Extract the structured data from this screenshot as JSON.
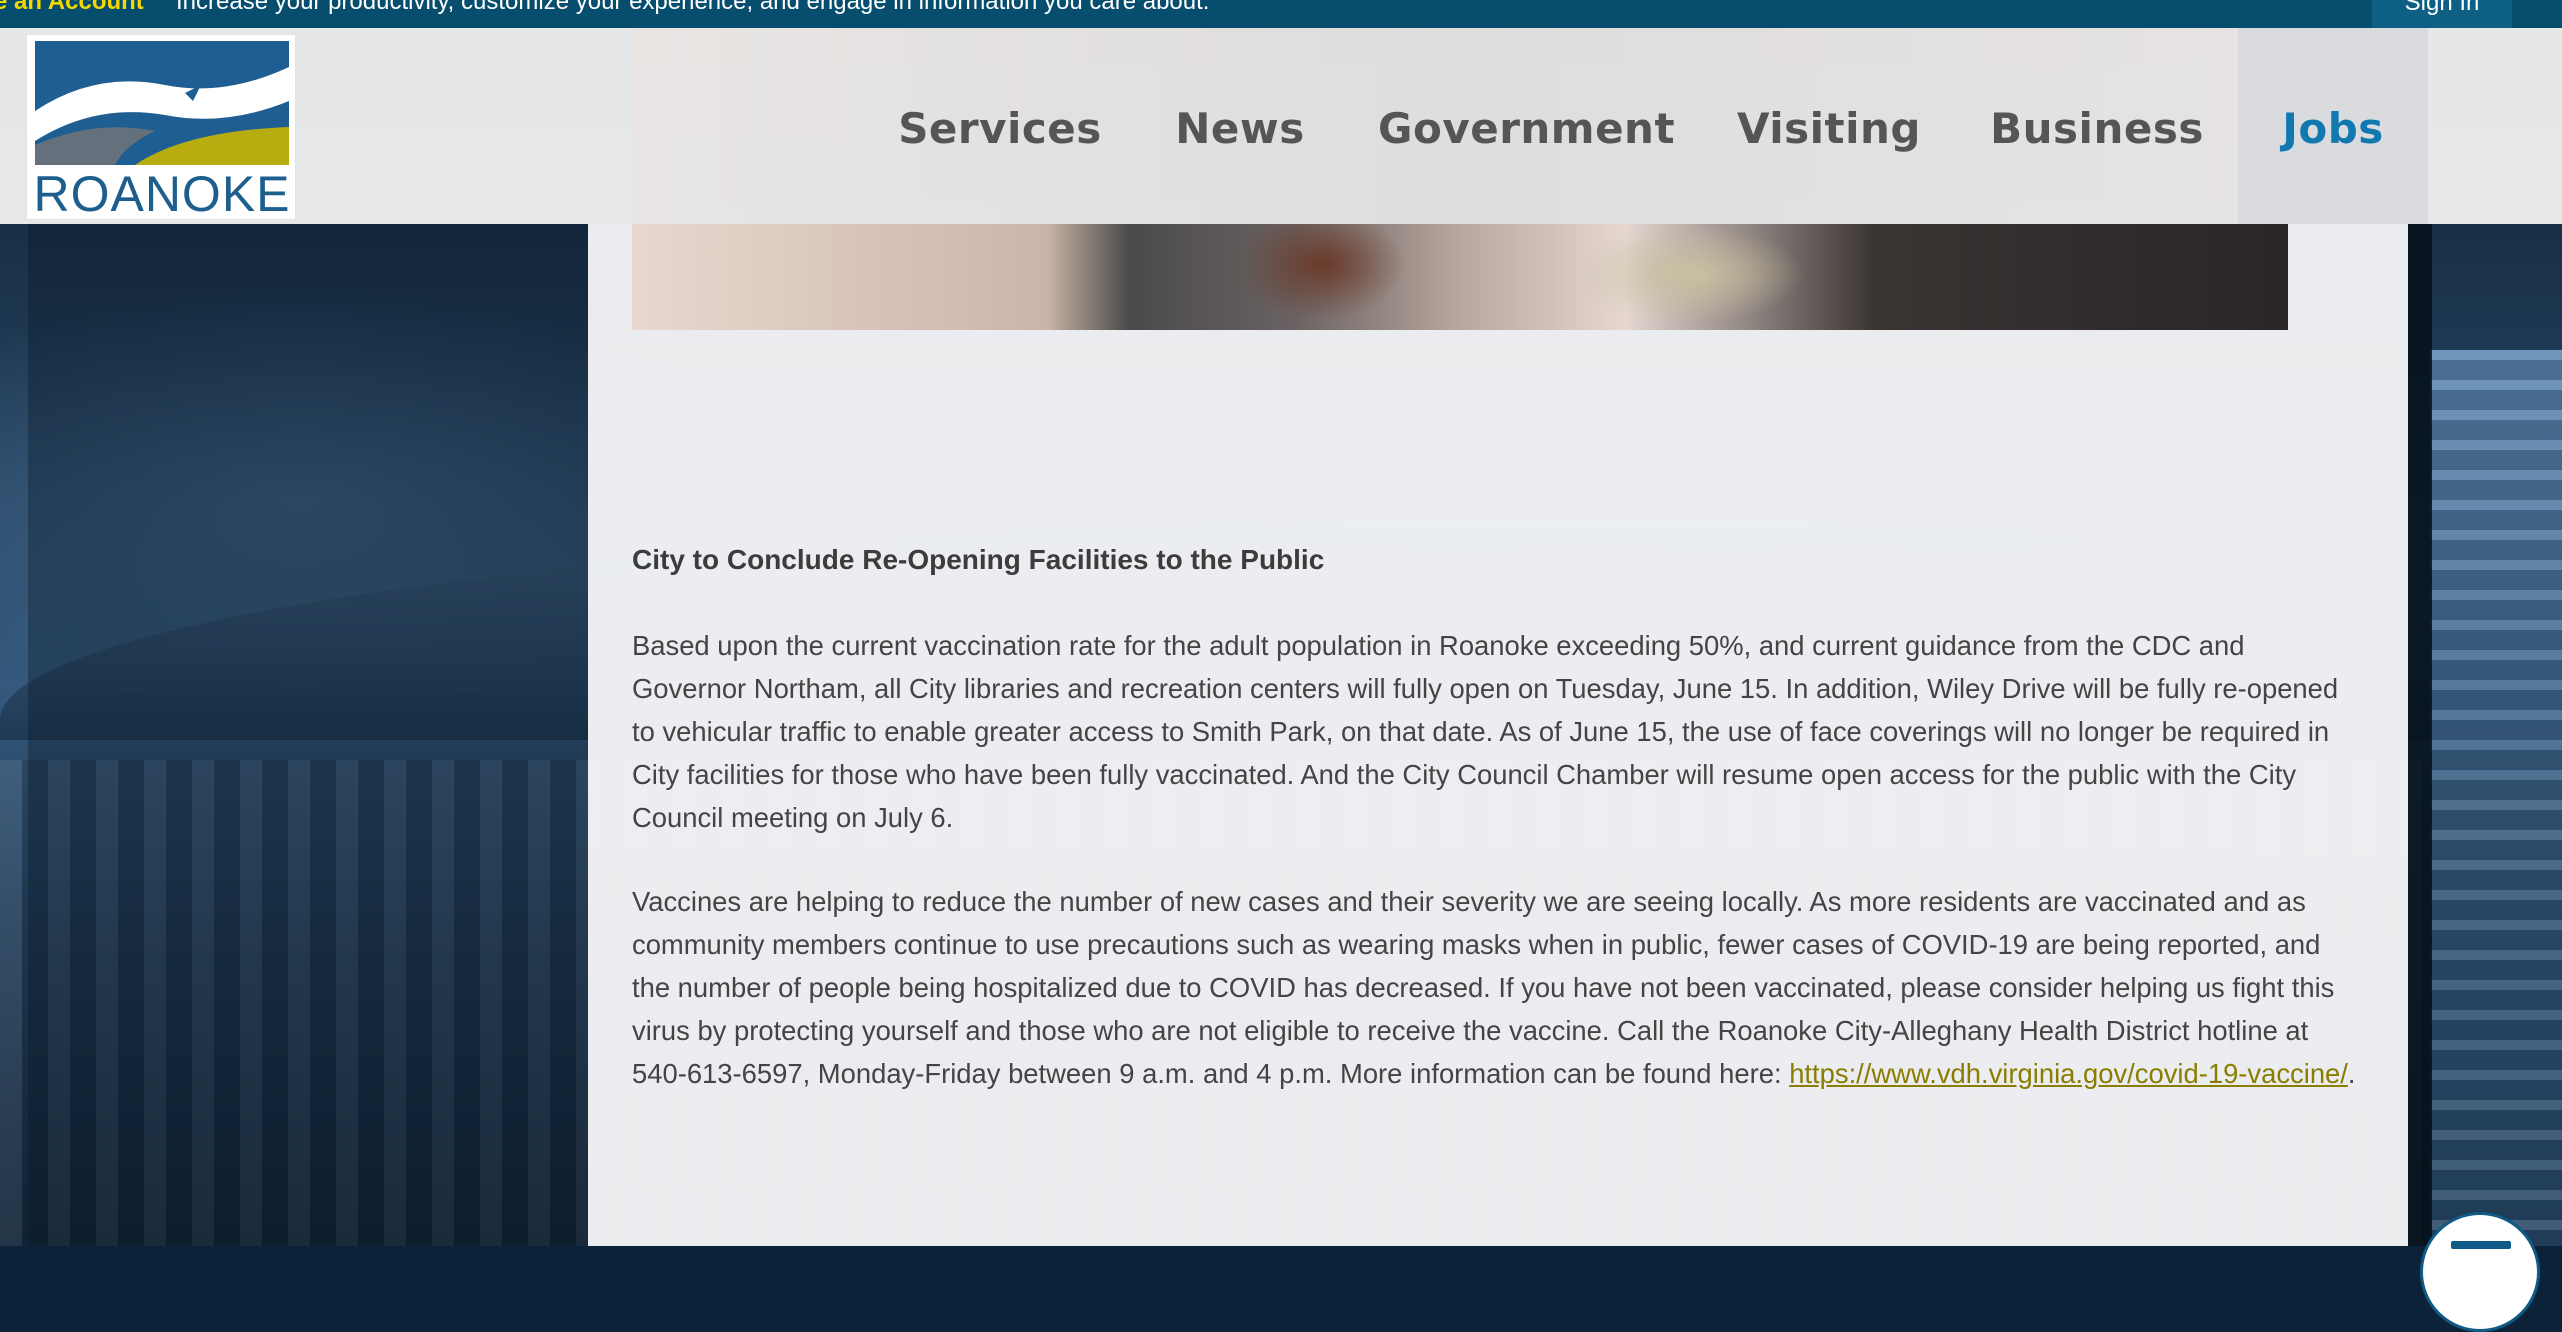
{
  "topbar": {
    "cta_label": "e an Account",
    "message": "Increase your productivity, customize your experience, and engage in information you care about.",
    "signin_label": "Sign In"
  },
  "logo": {
    "text": "ROANOKE"
  },
  "nav": {
    "items": [
      {
        "label": "Services"
      },
      {
        "label": "News"
      },
      {
        "label": "Government"
      },
      {
        "label": "Visiting"
      },
      {
        "label": "Business"
      },
      {
        "label": "Jobs",
        "active": true
      }
    ]
  },
  "article": {
    "title": "City to Conclude Re-Opening Facilities to the Public",
    "para1": "Based upon the current vaccination rate for the adult population in Roanoke exceeding 50%, and current guidance from the CDC and Governor Northam, all City libraries and recreation centers will fully open on Tuesday, June 15. In addition, Wiley Drive will be fully re-opened to vehicular traffic to enable greater access to Smith Park, on that date. As of June 15, the use of face coverings will no longer be required in City facilities for those who have been fully vaccinated. And the City Council Chamber will resume open access for the public with the City Council meeting on July 6.",
    "para2": "Vaccines are helping to reduce the number of new cases and their severity we are seeing locally. As more residents are vaccinated and as community members continue to use precautions such as wearing masks when in public, fewer cases of COVID-19 are being reported, and the number of people being hospitalized due to COVID has decreased. If you have not been vaccinated, please consider helping us fight this virus by protecting yourself and those who are not eligible to receive the vaccine. Call the Roanoke City-Alleghany Health District hotline at 540-613-6597, Monday-Friday between 9 a.m. and 4 p.m. More information can be found here:",
    "link_text": "https://www.vdh.virginia.gov/covid-19-vaccine/",
    "link_suffix": "."
  },
  "colors": {
    "topbar": "#064d6e",
    "cta": "#f4d800",
    "nav_text": "#555555",
    "nav_active": "#1179b0",
    "link": "#8a7d00"
  },
  "icons": {
    "fab": "chat-icon"
  }
}
